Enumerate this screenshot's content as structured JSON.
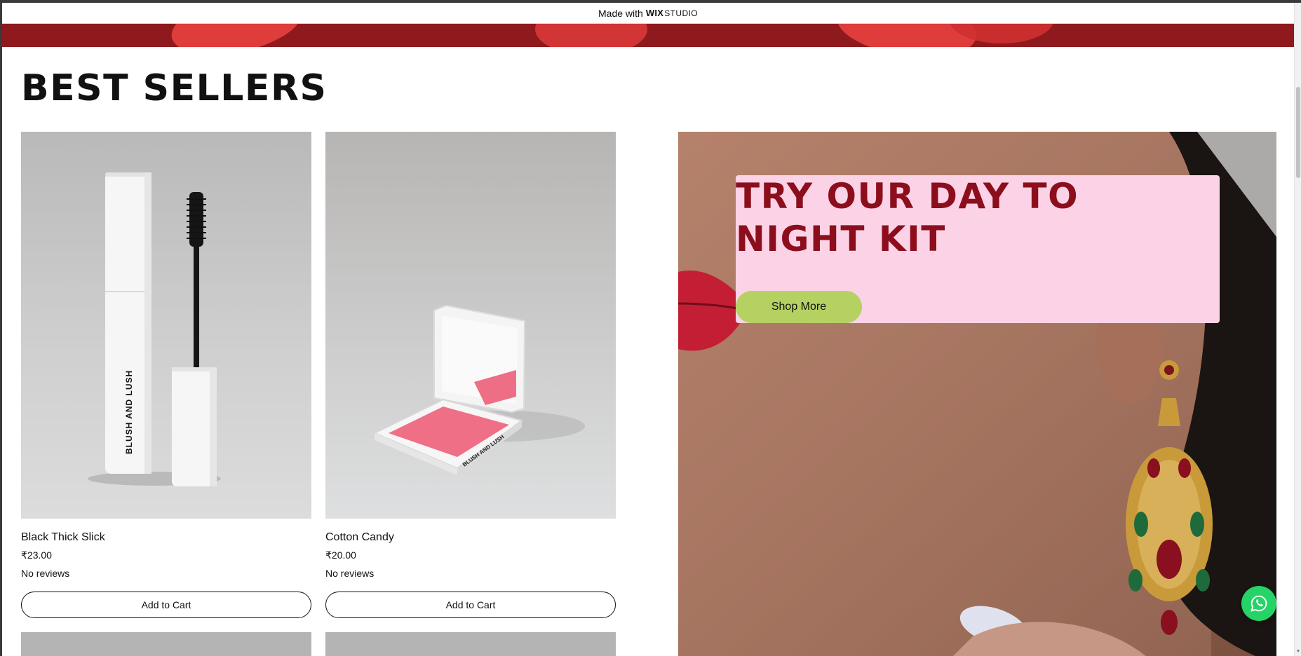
{
  "wix_banner": {
    "made_with": "Made with",
    "brand": "WIX",
    "product": "STUDIO"
  },
  "section": {
    "title": "BEST SELLERS"
  },
  "products": [
    {
      "name": "Black Thick Slick",
      "price": "₹23.00",
      "reviews": "No reviews",
      "button": "Add to Cart",
      "image_text": "BLUSH AND LUSH"
    },
    {
      "name": "Cotton Candy",
      "price": "₹20.00",
      "reviews": "No reviews",
      "button": "Add to Cart",
      "image_text": "BLUSH AND LUSH"
    }
  ],
  "promo": {
    "title_line1": "TRY OUR DAY TO",
    "title_line2": "NIGHT KIT",
    "button": "Shop More"
  },
  "colors": {
    "promo_box": "#fcd3e6",
    "promo_title": "#8c0e1d",
    "shop_button": "#b5d161",
    "hero_strip": "#8e1a1e",
    "whatsapp": "#25d366"
  },
  "icons": {
    "chat": "whatsapp-icon"
  }
}
